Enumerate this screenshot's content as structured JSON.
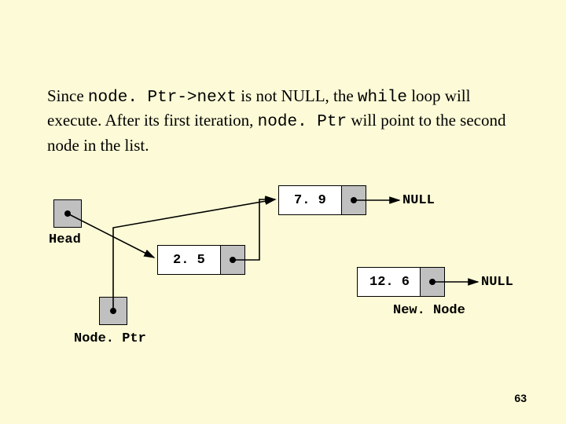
{
  "para": {
    "t1": "Since ",
    "c1": "node. Ptr->next",
    "t2": " is not NULL, the ",
    "c2": "while",
    "t3": " loop will execute. After its first iteration, ",
    "c3": "node. Ptr",
    "t4": " will point to the second node in the list."
  },
  "labels": {
    "head": "Head",
    "nodePtr": "Node. Ptr",
    "newNode": "New. Node",
    "null1": "NULL",
    "null2": "NULL"
  },
  "values": {
    "n1": "2. 5",
    "n2": "7. 9",
    "n3": "12. 6"
  },
  "pageNumber": "63"
}
